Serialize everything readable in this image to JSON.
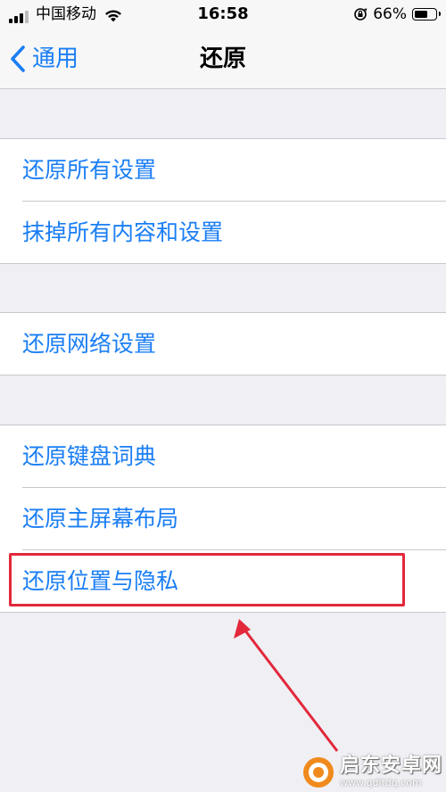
{
  "status_bar": {
    "carrier": "中国移动",
    "time": "16:58",
    "battery_percent": "66%",
    "battery_level": 0.66,
    "signal_bars": 3,
    "icons": [
      "signal-icon",
      "wifi-icon",
      "rotation-lock-icon",
      "battery-icon"
    ]
  },
  "nav": {
    "back_label": "通用",
    "back_icon": "chevron-left-icon",
    "title": "还原"
  },
  "groups": [
    {
      "items": [
        {
          "label": "还原所有设置"
        },
        {
          "label": "抹掉所有内容和设置"
        }
      ]
    },
    {
      "items": [
        {
          "label": "还原网络设置"
        }
      ]
    },
    {
      "items": [
        {
          "label": "还原键盘词典"
        },
        {
          "label": "还原主屏幕布局"
        },
        {
          "label": "还原位置与隐私"
        }
      ]
    }
  ],
  "annotation": {
    "highlight_color": "#e2283a",
    "arrow_color": "#e2283a",
    "highlighted_item": "还原位置与隐私"
  },
  "watermark": {
    "name": "启东安卓网",
    "url": "www.qdltdq.com"
  },
  "colors": {
    "accent": "#1a7ef4",
    "background": "#efeff4",
    "cell": "#ffffff",
    "separator": "#c8c7cc"
  }
}
